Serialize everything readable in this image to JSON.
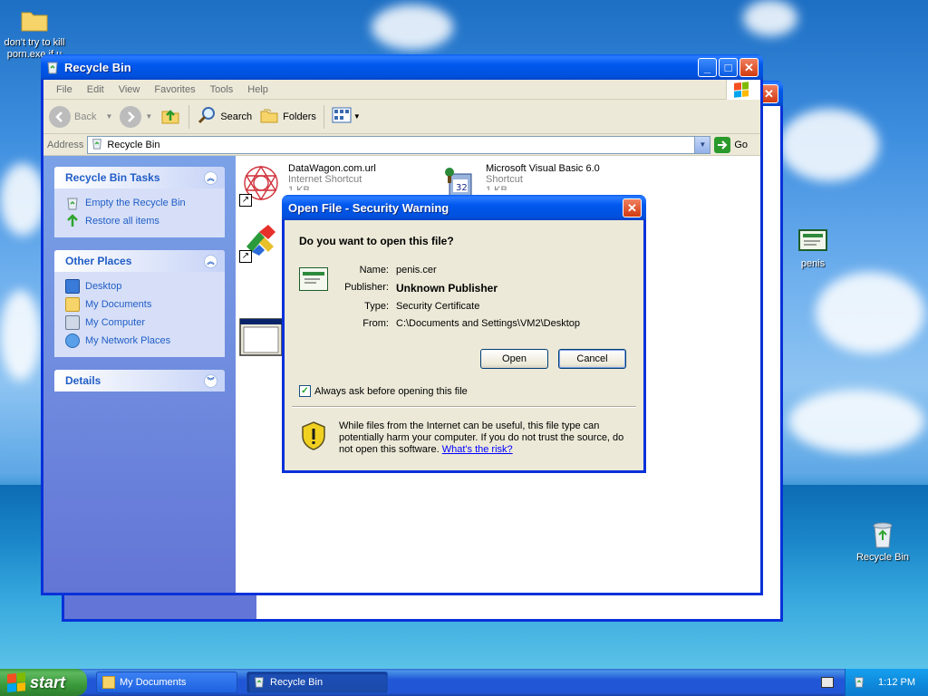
{
  "desktop": {
    "icons": [
      {
        "label": "don't try to kill porn.exe if u"
      },
      {
        "label": "penis"
      },
      {
        "label": "Recycle Bin"
      }
    ]
  },
  "explorer": {
    "title": "Recycle Bin",
    "menu": [
      "File",
      "Edit",
      "View",
      "Favorites",
      "Tools",
      "Help"
    ],
    "toolbar": {
      "back": "Back",
      "search": "Search",
      "folders": "Folders"
    },
    "address": {
      "label": "Address",
      "value": "Recycle Bin",
      "go": "Go"
    },
    "tasks": {
      "title": "Recycle Bin Tasks",
      "items": [
        "Empty the Recycle Bin",
        "Restore all items"
      ]
    },
    "other_places": {
      "title": "Other Places",
      "items": [
        "Desktop",
        "My Documents",
        "My Computer",
        "My Network Places"
      ]
    },
    "details": {
      "title": "Details"
    },
    "files": [
      {
        "name": "DataWagon.com.url",
        "type": "Internet Shortcut",
        "size": "1 KB"
      },
      {
        "name": "Microsoft Visual Basic 6.0",
        "type": "Shortcut",
        "size": "1 KB"
      }
    ]
  },
  "dialog": {
    "title": "Open File - Security Warning",
    "question": "Do you want to open this file?",
    "fields": [
      {
        "key": "Name:",
        "value": "penis.cer"
      },
      {
        "key": "Publisher:",
        "value": "Unknown Publisher"
      },
      {
        "key": "Type:",
        "value": "Security Certificate"
      },
      {
        "key": "From:",
        "value": "C:\\Documents and Settings\\VM2\\Desktop"
      }
    ],
    "open_label": "Open",
    "cancel_label": "Cancel",
    "checkbox_label": "Always ask before opening this file",
    "warning_text": "While files from the Internet can be useful, this file type can potentially harm your computer. If you do not trust the source, do not open this software.",
    "risk_link": "What's the risk?"
  },
  "taskbar": {
    "start": "start",
    "buttons": [
      "My Documents",
      "Recycle Bin"
    ],
    "clock": "1:12 PM"
  },
  "colors": {
    "xp_blue": "#0831d9",
    "link_blue": "#215dc6",
    "start_green": "#3a9a3a"
  }
}
